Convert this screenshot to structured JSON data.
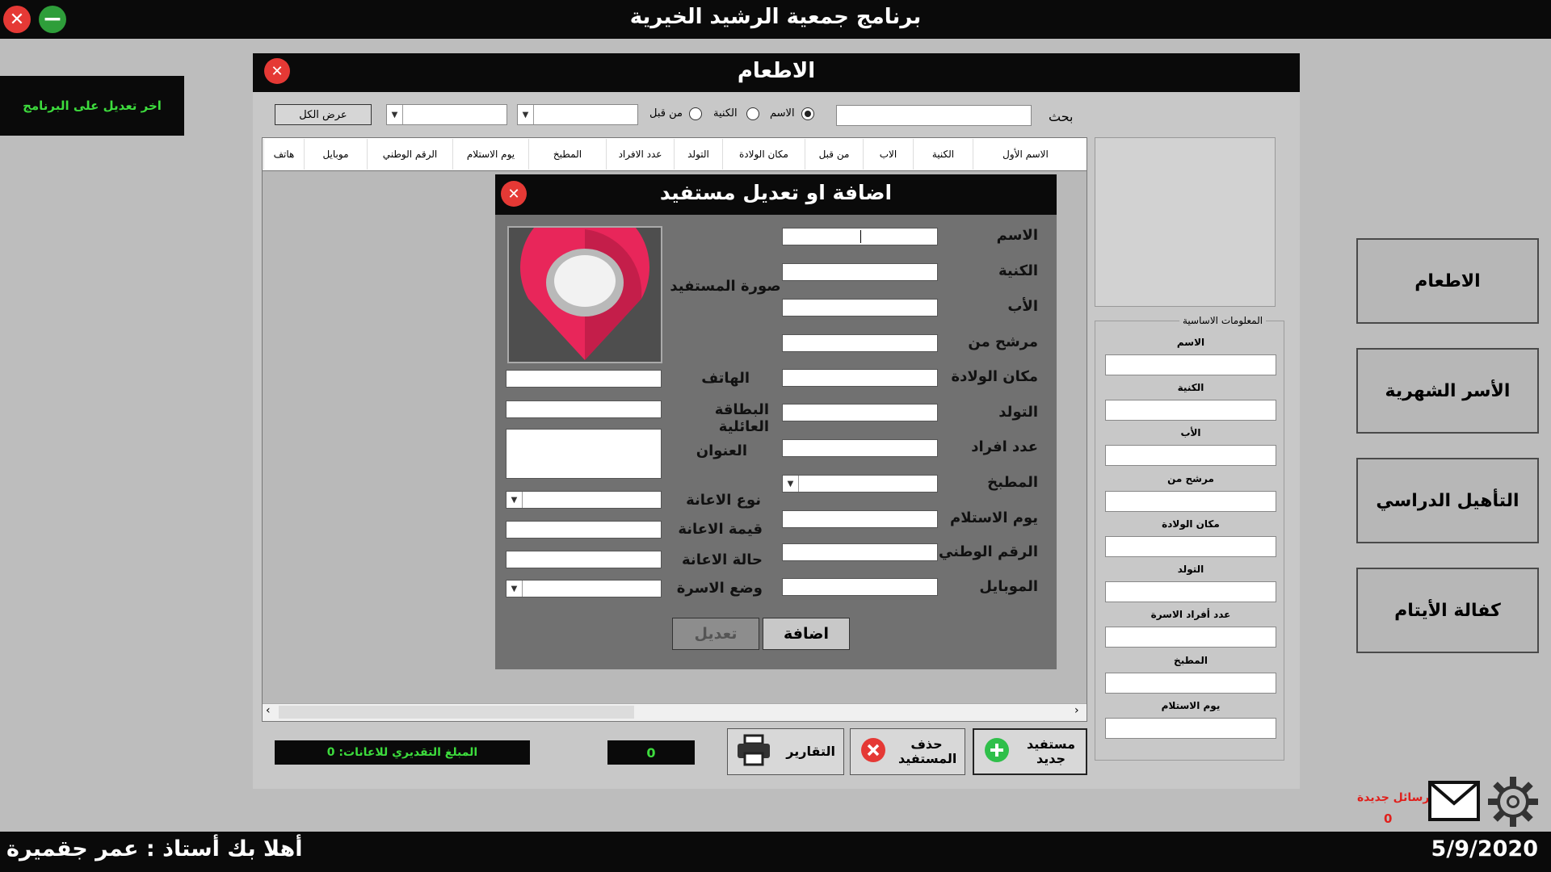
{
  "app": {
    "title": "برنامج جمعية الرشيد الخيرية",
    "last_edit": "اخر تعديل على البرنامج",
    "welcome": "أهلا بك أستاذ : عمر جقميرة",
    "date": "5/9/2020"
  },
  "nav": {
    "items": [
      {
        "label": "الاطعام"
      },
      {
        "label": "الأسر الشهرية"
      },
      {
        "label": "التأهيل الدراسي"
      },
      {
        "label": "كفالة الأيتام"
      }
    ],
    "messages_label": "رسائل جديدة",
    "messages_count": "0"
  },
  "main": {
    "title": "الاطعام",
    "search_label": "بحث",
    "search_value": "",
    "radios": [
      {
        "label": "الاسم",
        "selected": true
      },
      {
        "label": "الكنية",
        "selected": false
      },
      {
        "label": "من قبل",
        "selected": false
      }
    ],
    "show_all": "عرض الكل",
    "columns": [
      "الاسم الأول",
      "الكنية",
      "الاب",
      "من قبل",
      "مكان الولادة",
      "التولد",
      "عدد الافراد",
      "المطبخ",
      "يوم الاستلام",
      "الرقم الوطني",
      "موبايل",
      "هاتف"
    ],
    "estimated_amount": "المبلغ التقديري للاعانات: 0",
    "count": "0",
    "buttons": {
      "new": "مستفيد جديد",
      "delete": "حذف المستفيد",
      "reports": "التقارير"
    }
  },
  "basic_info": {
    "title": "المعلومات الاساسية",
    "fields": [
      "الاسم",
      "الكنية",
      "الأب",
      "مرشح من",
      "مكان الولادة",
      "التولد",
      "عدد أفراد الاسرة",
      "المطبخ",
      "يوم الاستلام"
    ]
  },
  "dialog": {
    "title": "اضافة او تعديل مستفيد",
    "left_fields": [
      "الاسم",
      "الكنية",
      "الأب",
      "مرشح من",
      "مكان الولادة",
      "التولد",
      "عدد افراد",
      "المطبخ",
      "يوم الاستلام",
      "الرقم الوطني",
      "الموبايل"
    ],
    "photo_label": "صورة المستفيد",
    "right_fields": [
      "الهاتف",
      "البطاقة العائلية",
      "العنوان",
      "نوع الاعانة",
      "قيمة الاعانة",
      "حالة الاعانة",
      "وضع الاسرة"
    ],
    "add_button": "اضافة",
    "edit_button": "تعديل"
  },
  "colors": {
    "header": "#0a0a0a",
    "accent_green": "#3ddc3d",
    "close_red": "#e53935",
    "min_green": "#2e9e3a",
    "pin_pink": "#e8265a",
    "messages_red": "#e0201c"
  },
  "icons": [
    "close-icon",
    "minimize-icon",
    "location-pin-icon",
    "printer-icon",
    "delete-icon",
    "add-icon",
    "mail-icon",
    "settings-icon"
  ]
}
